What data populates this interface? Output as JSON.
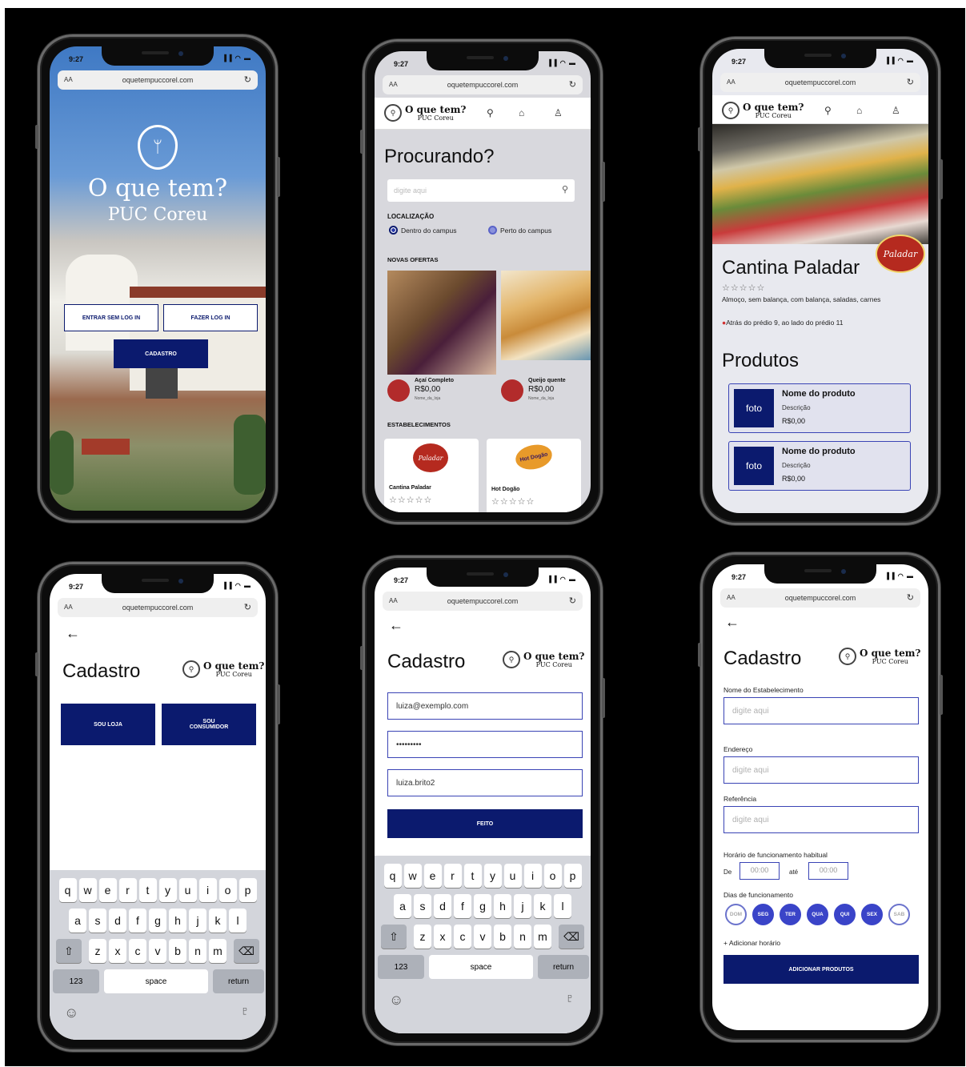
{
  "common": {
    "time": "9:27",
    "url": "oquetempuccorel.com",
    "aa": "AA",
    "reload_glyph": "↻",
    "signal_glyphs": "▐▐ ◠ ▬",
    "back_glyph": "←",
    "brand": {
      "line1": "O que tem?",
      "line2": "PUC Coreu",
      "icon": "fork-knife-icon"
    },
    "nav_icons": [
      "search-icon",
      "home-icon",
      "user-icon"
    ]
  },
  "welcome": {
    "title": "O que tem?",
    "subtitle": "PUC Coreu",
    "btn_guest": "ENTRAR SEM LOG IN",
    "btn_login": "FAZER LOG IN",
    "btn_signup": "CADASTRO"
  },
  "search": {
    "heading": "Procurando?",
    "placeholder": "digite aqui",
    "location_label": "LOCALIZAÇÃO",
    "option_inside": "Dentro do campus",
    "option_near": "Perto do campus",
    "offers_label": "NOVAS OFERTAS",
    "offers": [
      {
        "name": "Açaí Completo",
        "price": "R$0,00",
        "store": "Nome_da_loja"
      },
      {
        "name": "Queijo quente",
        "price": "R$0,00",
        "store": "Nome_da_loja"
      }
    ],
    "places_label": "ESTABELECIMENTOS",
    "places": [
      {
        "name": "Cantina Paladar",
        "rating": "☆☆☆☆☆",
        "logo": "Paladar"
      },
      {
        "name": "Hot Dogão",
        "rating": "☆☆☆☆☆",
        "logo": "Hot Dogão"
      }
    ]
  },
  "store": {
    "name": "Cantina Paladar",
    "logo": "Paladar",
    "rating": "☆☆☆☆☆",
    "description": "Almoço, sem balança, com balança, saladas, carnes",
    "location": "Atrás do prédio 9, ao lado do prédio 11",
    "products_heading": "Produtos",
    "products": [
      {
        "photo": "foto",
        "name": "Nome do produto",
        "desc": "Descrição",
        "price": "R$0,00"
      },
      {
        "photo": "foto",
        "name": "Nome do produto",
        "desc": "Descrição",
        "price": "R$0,00"
      }
    ]
  },
  "signup_choice": {
    "title": "Cadastro",
    "btn_store": "SOU LOJA",
    "btn_consumer": "SOU CONSUMIDOR"
  },
  "signup_form": {
    "title": "Cadastro",
    "email": "luiza@exemplo.com",
    "password": "•••••••••",
    "username": "luiza.brito2",
    "submit": "FEITO"
  },
  "keyboard": {
    "row1": [
      "q",
      "w",
      "e",
      "r",
      "t",
      "y",
      "u",
      "i",
      "o",
      "p"
    ],
    "row2": [
      "a",
      "s",
      "d",
      "f",
      "g",
      "h",
      "j",
      "k",
      "l"
    ],
    "row3": [
      "z",
      "x",
      "c",
      "v",
      "b",
      "n",
      "m"
    ],
    "shift": "⇧",
    "backspace": "⌫",
    "numbers": "123",
    "space": "space",
    "return": "return",
    "emoji": "☺",
    "mic": "♇"
  },
  "store_form": {
    "title": "Cadastro",
    "name_label": "Nome do Estabelecimento",
    "name_placeholder": "digite aqui",
    "address_label": "Endereço",
    "address_placeholder": "digite aqui",
    "reference_label": "Referência",
    "reference_placeholder": "digite aqui",
    "hours_label": "Horário de funcionamento habitual",
    "from_label": "De",
    "from_value": "00:00",
    "to_label": "até",
    "to_value": "00:00",
    "days_label": "Dias de funcionamento",
    "days": [
      {
        "label": "DOM",
        "active": false
      },
      {
        "label": "SEG",
        "active": true
      },
      {
        "label": "TER",
        "active": true
      },
      {
        "label": "QUA",
        "active": true
      },
      {
        "label": "QUI",
        "active": true
      },
      {
        "label": "SEX",
        "active": true
      },
      {
        "label": "SAB",
        "active": false
      }
    ],
    "add_hours": "+ Adicionar horário",
    "submit": "ADICIONAR PRODUTOS"
  },
  "colors": {
    "navy": "#0b1a6e",
    "accent_border": "#3a44b5",
    "card_bg": "#e4e5ef"
  }
}
